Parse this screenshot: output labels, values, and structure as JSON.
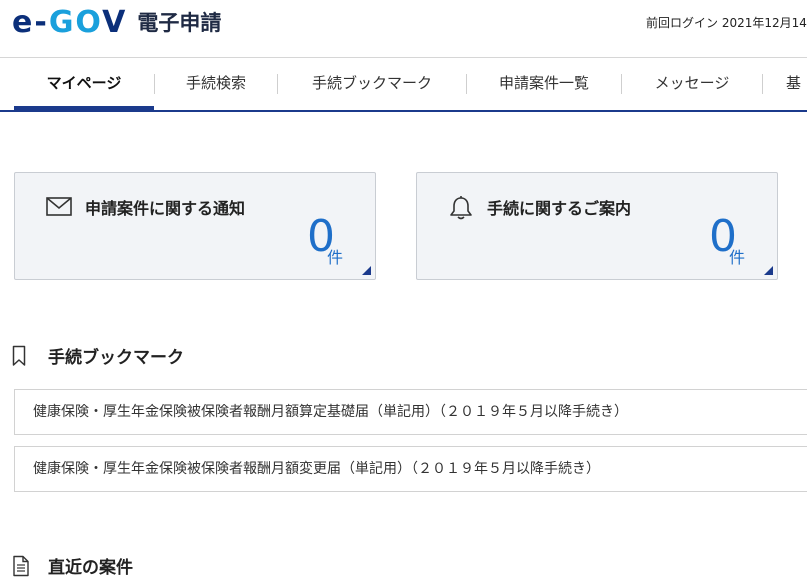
{
  "header": {
    "logo_text": {
      "e": "e",
      "dash": "-",
      "go": "GO",
      "v": "V"
    },
    "site_title": "電子申請",
    "last_login": "前回ログイン 2021年12月14"
  },
  "nav": {
    "tabs": [
      {
        "label": "マイページ",
        "active": true
      },
      {
        "label": "手続検索"
      },
      {
        "label": "手続ブックマーク"
      },
      {
        "label": "申請案件一覧"
      },
      {
        "label": "メッセージ"
      },
      {
        "label": "基"
      }
    ]
  },
  "cards": [
    {
      "icon": "mail-icon",
      "title": "申請案件に関する通知",
      "count": "0",
      "unit": "件"
    },
    {
      "icon": "bell-icon",
      "title": "手続に関するご案内",
      "count": "0",
      "unit": "件"
    }
  ],
  "bookmarks": {
    "title": "手続ブックマーク",
    "icon": "bookmark-icon",
    "items": [
      "健康保険・厚生年金保険被保険者報酬月額算定基礎届（単記用）（２０１９年５月以降手続き）",
      "健康保険・厚生年金保険被保険者報酬月額変更届（単記用）（２０１９年５月以降手続き）"
    ]
  },
  "recent": {
    "title": "直近の案件",
    "icon": "document-icon"
  },
  "colors": {
    "brand_navy": "#1b3a8c",
    "accent_blue": "#1f6fc9",
    "logo_cyan": "#1aa0dc"
  }
}
